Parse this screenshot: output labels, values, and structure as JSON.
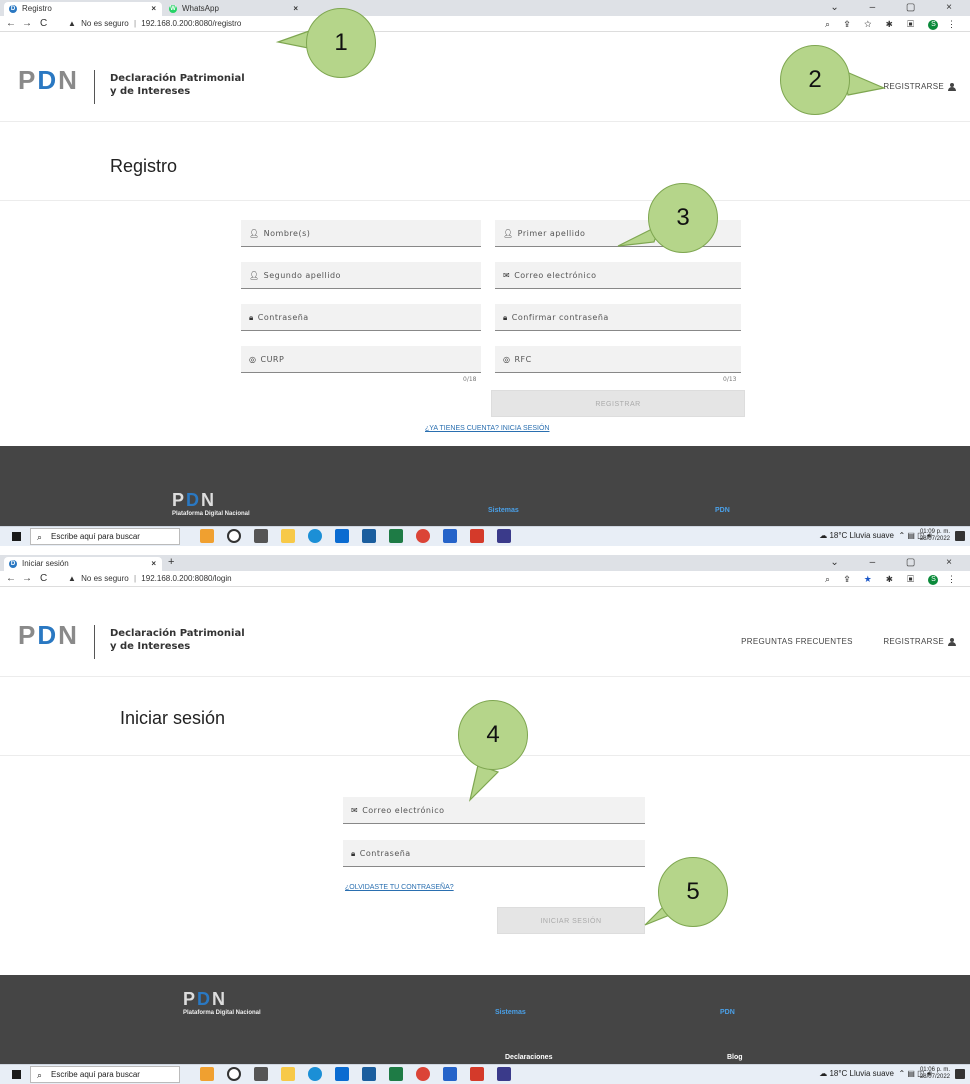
{
  "shot1": {
    "tabs": [
      {
        "label": "Registro",
        "favicon_color": "#2a78c2",
        "favicon": "D"
      },
      {
        "label": "WhatsApp",
        "favicon_color": "#25d366",
        "favicon": "W"
      }
    ],
    "address": {
      "warning": "No es seguro",
      "url": "192.168.0.200:8080/registro"
    },
    "site_title_line1": "Declaración Patrimonial",
    "site_title_line2": "y de Intereses",
    "logo_text": {
      "p": "P",
      "d": "D",
      "n": "N"
    },
    "header_links": [
      "REGISTRARSE"
    ],
    "page_title": "Registro",
    "fields": {
      "nombre": "Nombre(s)",
      "primer_apellido": "Primer apellido",
      "segundo_apellido": "Segundo apellido",
      "correo": "Correo electrónico",
      "contrasena": "Contraseña",
      "confirmar": "Confirmar contraseña",
      "curp": "CURP",
      "rfc": "RFC"
    },
    "curp_counter": "0/18",
    "rfc_counter": "0/13",
    "submit_label": "REGISTRAR",
    "login_link": "¿YA TIENES CUENTA? INICIA SESIÓN",
    "footer": {
      "logo_small": "Plataforma Digital Nacional",
      "col1": "Sistemas",
      "col2": "PDN"
    },
    "taskbar": {
      "search_placeholder": "Escribe aquí para buscar",
      "weather": "18°C  Lluvia suave",
      "time": "01:09 p. m.",
      "date": "28/07/2022"
    }
  },
  "shot2": {
    "tabs": [
      {
        "label": "Iniciar sesión",
        "favicon_color": "#2a78c2",
        "favicon": "D"
      }
    ],
    "new_tab": "+",
    "address": {
      "warning": "No es seguro",
      "url": "192.168.0.200:8080/login"
    },
    "site_title_line1": "Declaración Patrimonial",
    "site_title_line2": "y de Intereses",
    "header_links": [
      "PREGUNTAS FRECUENTES",
      "REGISTRARSE"
    ],
    "page_title": "Iniciar sesión",
    "fields": {
      "correo": "Correo electrónico",
      "contrasena": "Contraseña"
    },
    "forgot_link": "¿OLVIDASTE TU CONTRASEÑA?",
    "submit_label": "INICIAR SESIÓN",
    "footer": {
      "logo_small": "Plataforma Digital Nacional",
      "col1": "Sistemas",
      "col1_link": "Declaraciones",
      "col2": "PDN",
      "col2_link": "Blog"
    },
    "taskbar": {
      "search_placeholder": "Escribe aquí para buscar",
      "weather": "18°C  Lluvia suave",
      "time": "01:06 p. m.",
      "date": "28/07/2022"
    }
  },
  "callouts": [
    "1",
    "2",
    "3",
    "4",
    "5"
  ],
  "colors": {
    "callout_fill": "#b5d58a",
    "brand_blue": "#2a78c2",
    "footer_bg": "#454545"
  }
}
